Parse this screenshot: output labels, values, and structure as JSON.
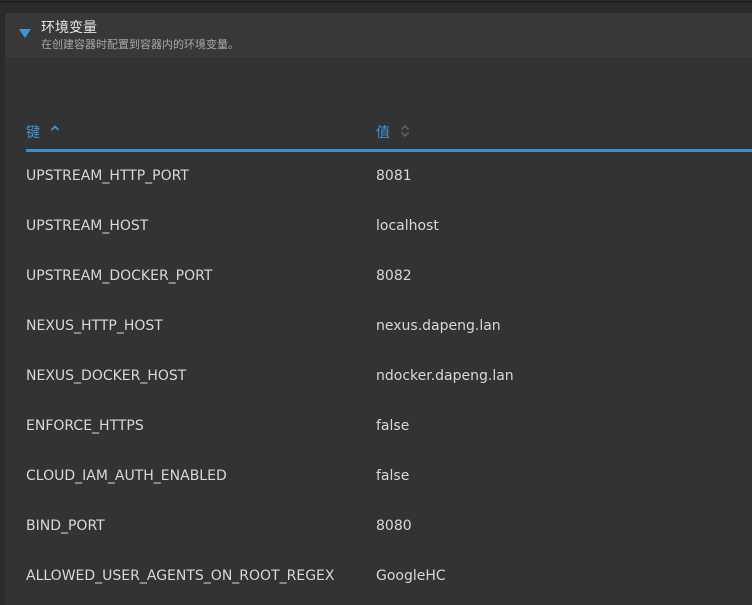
{
  "section": {
    "title": "环境变量",
    "subtitle": "在创建容器时配置到容器内的环境变量。"
  },
  "table": {
    "headers": {
      "key": "键",
      "value": "值"
    },
    "rows": [
      {
        "key": "UPSTREAM_HTTP_PORT",
        "value": "8081"
      },
      {
        "key": "UPSTREAM_HOST",
        "value": "localhost"
      },
      {
        "key": "UPSTREAM_DOCKER_PORT",
        "value": "8082"
      },
      {
        "key": "NEXUS_HTTP_HOST",
        "value": "nexus.dapeng.lan"
      },
      {
        "key": "NEXUS_DOCKER_HOST",
        "value": "ndocker.dapeng.lan"
      },
      {
        "key": "ENFORCE_HTTPS",
        "value": "false"
      },
      {
        "key": "CLOUD_IAM_AUTH_ENABLED",
        "value": "false"
      },
      {
        "key": "BIND_PORT",
        "value": "8080"
      },
      {
        "key": "ALLOWED_USER_AGENTS_ON_ROOT_REGEX",
        "value": "GoogleHC"
      }
    ]
  },
  "icons": {
    "toggle": "caret-down-icon",
    "sort_active": "sort-ascending-icon",
    "sort_inactive": "sort-icon"
  },
  "colors": {
    "accent": "#3d95d6",
    "panel_bg": "#333333",
    "header_bg": "#383838",
    "text": "#d8d8d8",
    "muted_text": "#a8a8a8"
  }
}
